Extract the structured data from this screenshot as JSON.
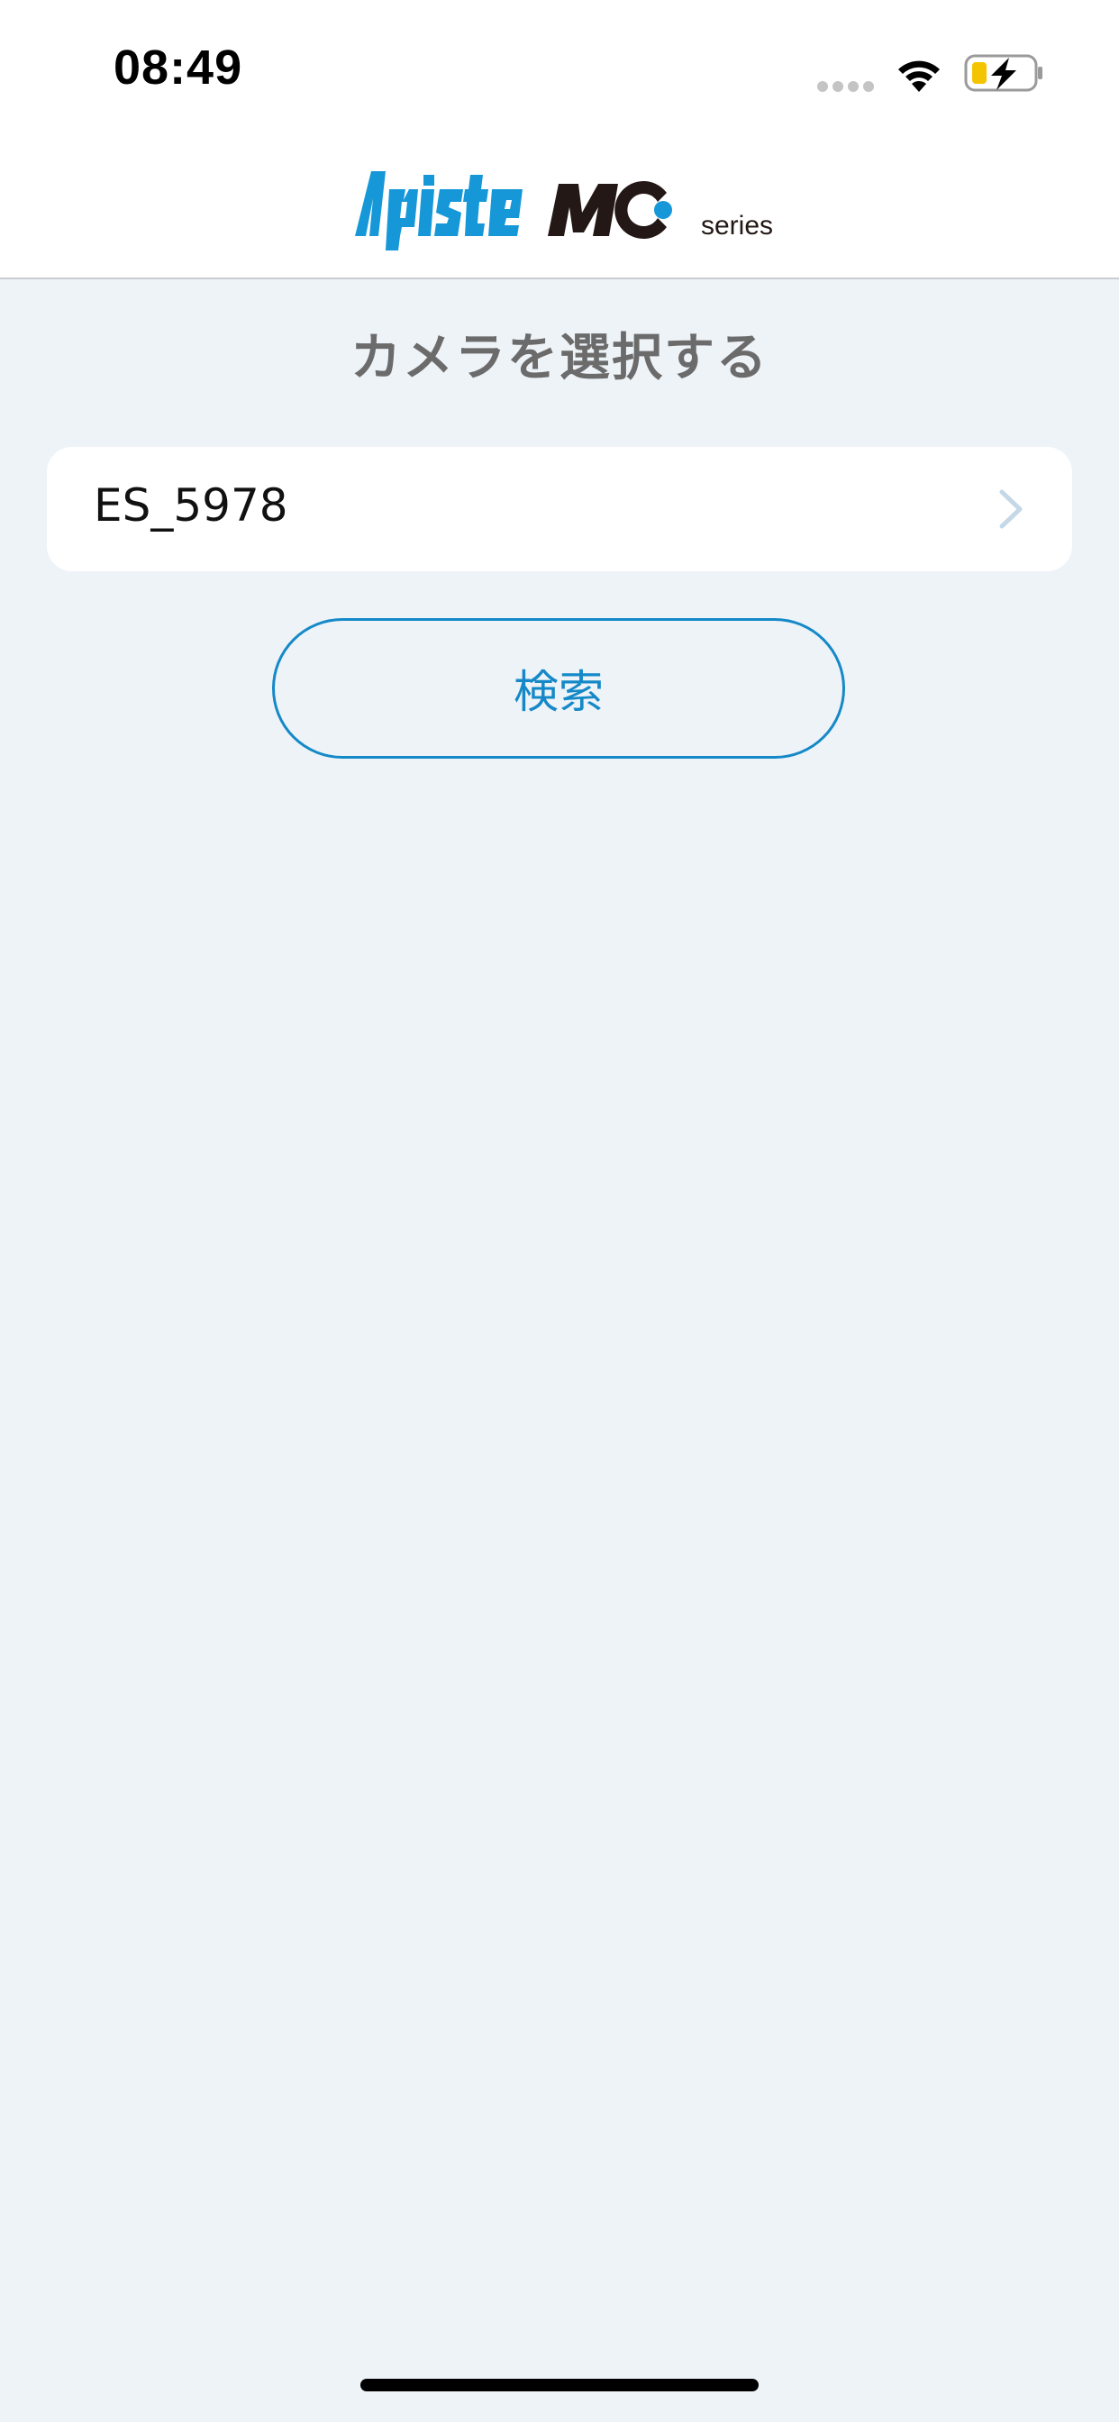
{
  "status_bar": {
    "time": "08:49",
    "signal_icon": "cellular-signal-dots-icon",
    "wifi_icon": "wifi-icon",
    "battery_icon": "battery-charging-icon",
    "battery_color": "#f5c400"
  },
  "header": {
    "logo_text": "Apiste MC series",
    "logo_primary_color": "#1697d8",
    "logo_secondary_color": "#231815"
  },
  "main": {
    "title": "カメラを選択する",
    "cameras": [
      {
        "name": "ES_5978"
      }
    ],
    "search_button_label": "検索",
    "accent_color": "#1589c8",
    "background_color": "#eef3f8"
  }
}
